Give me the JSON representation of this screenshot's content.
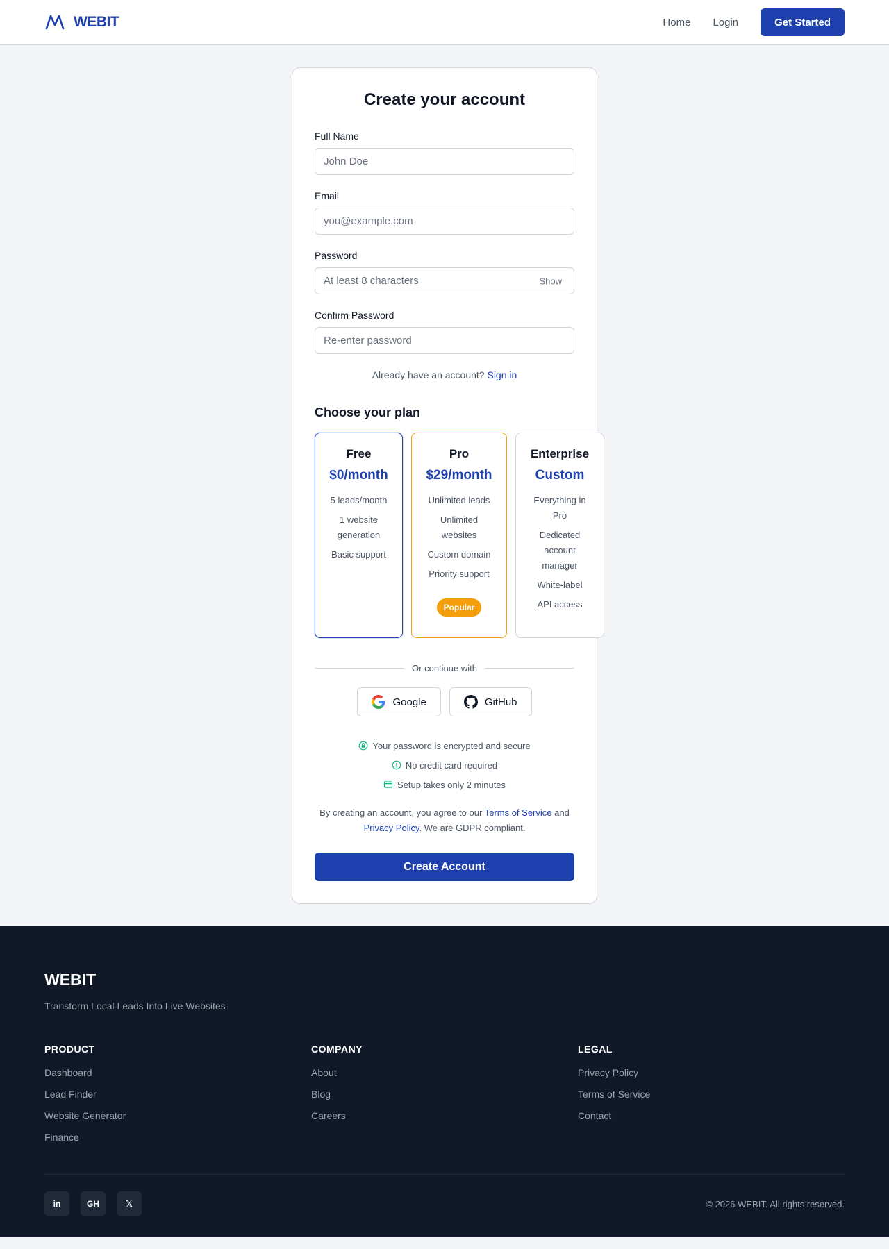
{
  "header": {
    "brand": "WEBIT",
    "nav": {
      "home": "Home",
      "login": "Login",
      "cta": "Get Started"
    }
  },
  "form": {
    "title": "Create your account",
    "full_name": {
      "label": "Full Name",
      "placeholder": "John Doe",
      "value": ""
    },
    "email": {
      "label": "Email",
      "placeholder": "you@example.com",
      "value": ""
    },
    "password": {
      "label": "Password",
      "placeholder": "At least 8 characters",
      "value": "",
      "toggle": "Show"
    },
    "confirm_password": {
      "label": "Confirm Password",
      "placeholder": "Re-enter password",
      "value": ""
    },
    "signin_prompt": "Already have an account?",
    "signin_link": "Sign in"
  },
  "plans": {
    "heading": "Choose your plan",
    "selected": "Free",
    "items": [
      {
        "name": "Free",
        "price": "$0/month",
        "features": [
          "5 leads/month",
          "1 website generation",
          "Basic support"
        ]
      },
      {
        "name": "Pro",
        "price": "$29/month",
        "features": [
          "Unlimited leads",
          "Unlimited websites",
          "Custom domain",
          "Priority support"
        ],
        "badge": "Popular"
      },
      {
        "name": "Enterprise",
        "price": "Custom",
        "features": [
          "Everything in Pro",
          "Dedicated account manager",
          "White-label",
          "API access"
        ]
      }
    ]
  },
  "social": {
    "divider": "Or continue with",
    "google": "Google",
    "github": "GitHub"
  },
  "trust": [
    {
      "icon": "lock-icon",
      "text": "Your password is encrypted and secure"
    },
    {
      "icon": "info-icon",
      "text": "No credit card required"
    },
    {
      "icon": "card-icon",
      "text": "Setup takes only 2 minutes"
    }
  ],
  "legal": {
    "prefix": "By creating an account, you agree to our",
    "terms": "Terms of Service",
    "and": "and",
    "privacy": "Privacy Policy",
    "suffix": ". We are GDPR compliant."
  },
  "submit": "Create Account",
  "footer": {
    "brand": "WEBIT",
    "tagline": "Transform Local Leads Into Live Websites",
    "columns": [
      {
        "title": "PRODUCT",
        "links": [
          "Dashboard",
          "Lead Finder",
          "Website Generator",
          "Finance"
        ]
      },
      {
        "title": "COMPANY",
        "links": [
          "About",
          "Blog",
          "Careers"
        ]
      },
      {
        "title": "LEGAL",
        "links": [
          "Privacy Policy",
          "Terms of Service",
          "Contact"
        ]
      }
    ],
    "socials": [
      "in",
      "GH",
      "𝕏"
    ],
    "copyright": "© 2026 WEBIT. All rights reserved."
  },
  "colors": {
    "brand": "#1e40af",
    "accent": "#f59e0b",
    "success": "#10b981",
    "footer_bg": "#111827"
  }
}
